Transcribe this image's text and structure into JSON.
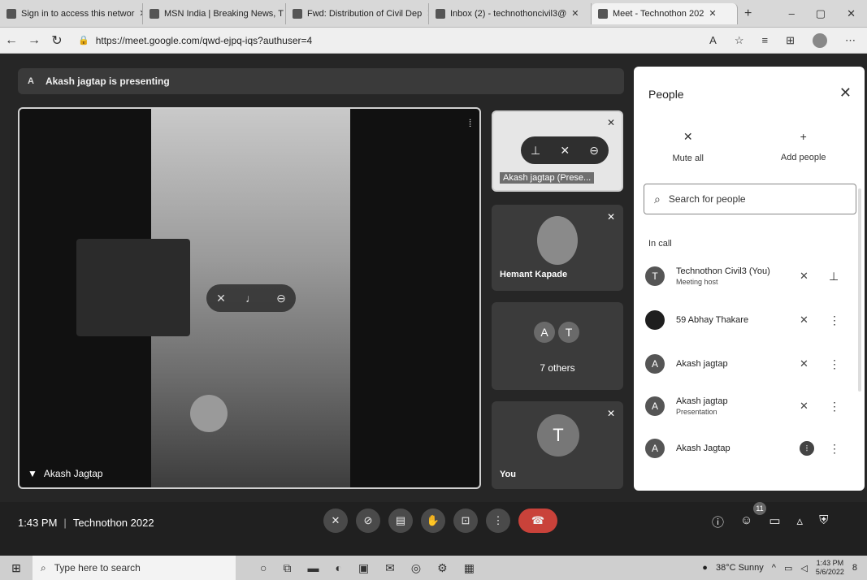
{
  "browser": {
    "tabs": [
      {
        "label": "Sign in to access this networ"
      },
      {
        "label": "MSN India | Breaking News, T"
      },
      {
        "label": "Fwd: Distribution of Civil Dep"
      },
      {
        "label": "Inbox (2) - technothoncivil3@"
      },
      {
        "label": "Meet - Technothon 202"
      }
    ],
    "url": "https://meet.google.com/qwd-ejpq-iqs?authuser=4"
  },
  "meet": {
    "presenter_initial": "A",
    "presenting_banner": "Akash jagtap is presenting",
    "main_tile_name": "Akash Jagtap",
    "side_tiles": {
      "presentation_label": "Akash jagtap (Prese...",
      "hemant_label": "Hemant Kapade",
      "others_initials": [
        "A",
        "T"
      ],
      "others_label": "7 others",
      "you_initial": "T",
      "you_label": "You"
    },
    "bottom": {
      "time": "1:43 PM",
      "meeting_name": "Technothon 2022",
      "people_count": "11"
    }
  },
  "people_panel": {
    "title": "People",
    "mute_all": "Mute all",
    "add_people": "Add people",
    "search_placeholder": "Search for people",
    "in_call_label": "In call",
    "people": [
      {
        "initial": "T",
        "name": "Technothon Civil3 (You)",
        "sub": "Meeting host"
      },
      {
        "initial": "",
        "name": "59 Abhay Thakare",
        "sub": ""
      },
      {
        "initial": "A",
        "name": "Akash jagtap",
        "sub": ""
      },
      {
        "initial": "A",
        "name": "Akash jagtap",
        "sub": "Presentation"
      },
      {
        "initial": "A",
        "name": "Akash Jagtap",
        "sub": ""
      }
    ]
  },
  "taskbar": {
    "search_placeholder": "Type here to search",
    "weather": "38°C Sunny",
    "clock_time": "1:43 PM",
    "clock_date": "5/6/2022",
    "notif_count": "8"
  }
}
